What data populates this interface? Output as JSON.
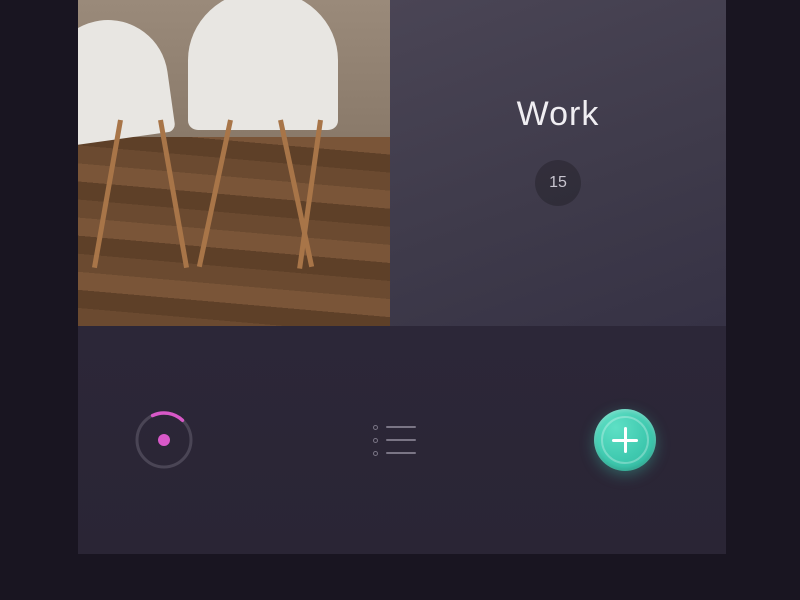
{
  "category": {
    "title": "Work",
    "count": "15"
  },
  "nav": {
    "progress_icon": "progress-ring-icon",
    "list_icon": "list-icon",
    "add_icon": "plus-icon"
  },
  "colors": {
    "accent_pink": "#d858c8",
    "accent_teal": "#3fc9af",
    "bg_dark": "#191521",
    "bg_tile": "#3e3a4a",
    "bg_bar": "#2c2738"
  }
}
